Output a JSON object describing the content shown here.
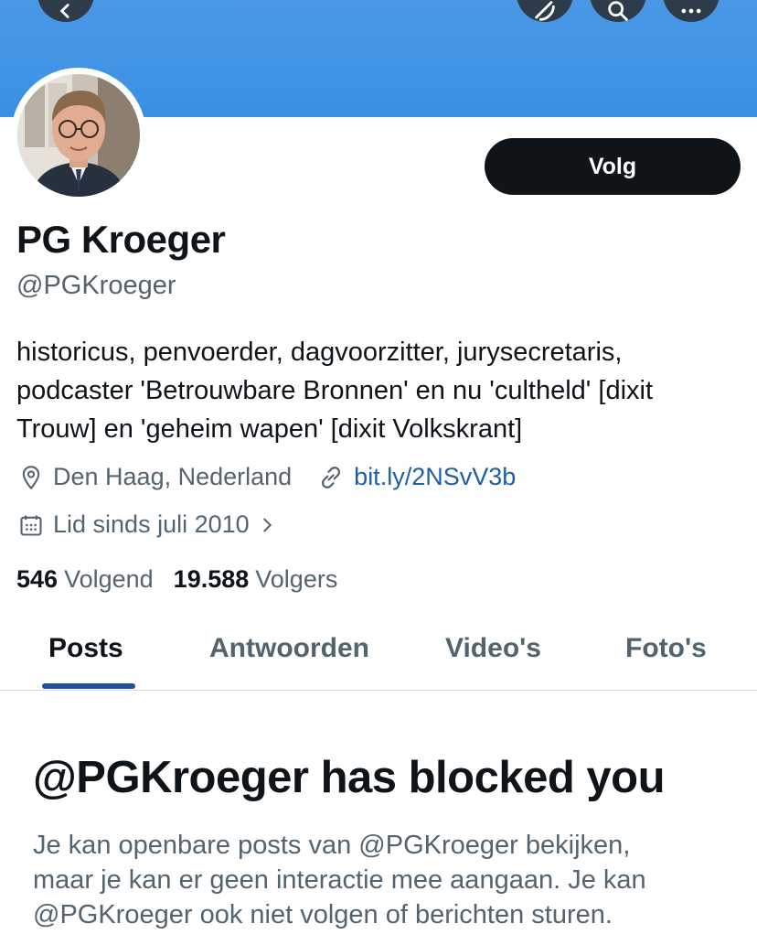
{
  "header": {
    "banner_color": "#3b90e4",
    "icons": [
      "back-arrow-icon",
      "grok-icon",
      "search-icon",
      "more-icon"
    ]
  },
  "profile": {
    "name": "PG Kroeger",
    "handle": "@PGKroeger",
    "follow_label": "Volg",
    "bio_lines": [
      "historicus, penvoerder, dagvoorzitter, jurysecretaris,",
      "podcaster 'Betrouwbare Bronnen' en nu 'cultheld' [dixit",
      "Trouw] en 'geheim wapen' [dixit Volkskrant]"
    ],
    "location": "Den Haag, Nederland",
    "website": "bit.ly/2NSvV3b",
    "joined": "Lid sinds juli 2010",
    "following_count": "546",
    "following_label": "Volgend",
    "followers_count": "19.588",
    "followers_label": "Volgers"
  },
  "tabs": [
    {
      "label": "Posts",
      "active": true
    },
    {
      "label": "Antwoorden",
      "active": false
    },
    {
      "label": "Video's",
      "active": false
    },
    {
      "label": "Foto's",
      "active": false
    }
  ],
  "blocked": {
    "title": "@PGKroeger has blocked you",
    "lines": [
      "Je kan openbare posts van @PGKroeger bekijken,",
      "maar je kan er geen interactie mee aangaan. Je kan",
      "@PGKroeger ook niet volgen of berichten sturen."
    ]
  },
  "colors": {
    "link": "#1d5fa8",
    "secondary_text": "#536471",
    "button_dark": "#0f1419",
    "tab_indicator": "#1d4fa0"
  }
}
